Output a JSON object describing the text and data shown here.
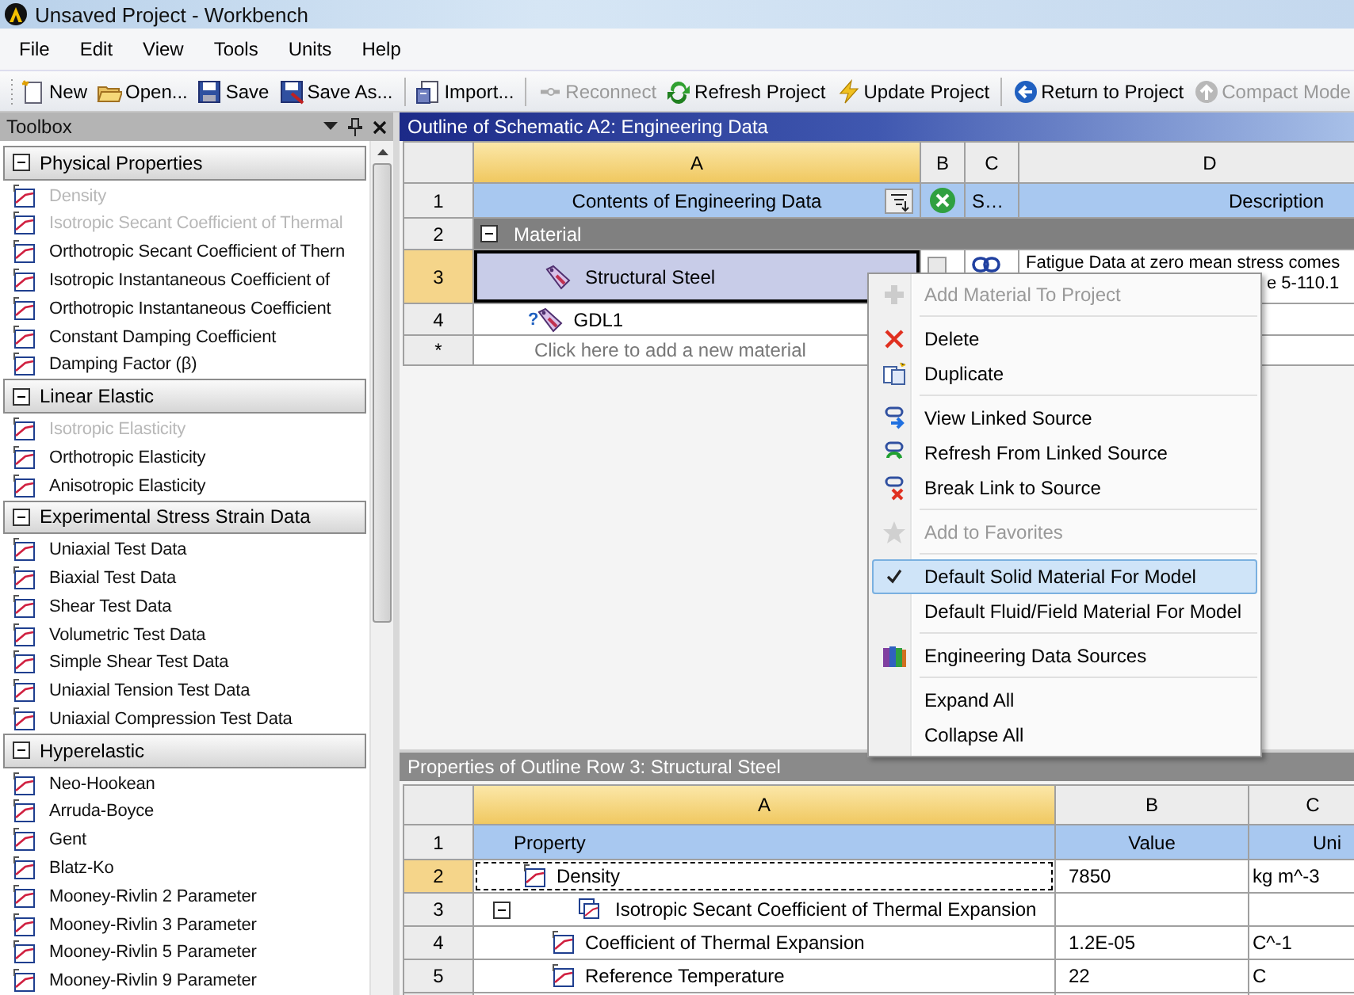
{
  "window": {
    "title": "Unsaved Project - Workbench"
  },
  "menu_bar": [
    "File",
    "Edit",
    "View",
    "Tools",
    "Units",
    "Help"
  ],
  "toolbar": [
    {
      "kind": "button",
      "label": "New",
      "disabled": false
    },
    {
      "kind": "button",
      "label": "Open...",
      "disabled": false
    },
    {
      "kind": "button",
      "label": "Save",
      "disabled": false
    },
    {
      "kind": "button",
      "label": "Save As...",
      "disabled": false
    },
    {
      "kind": "separator"
    },
    {
      "kind": "button",
      "label": "Import...",
      "disabled": false
    },
    {
      "kind": "separator"
    },
    {
      "kind": "button",
      "label": "Reconnect",
      "disabled": true
    },
    {
      "kind": "button",
      "label": "Refresh Project",
      "disabled": false
    },
    {
      "kind": "button",
      "label": "Update Project",
      "disabled": false
    },
    {
      "kind": "separator"
    },
    {
      "kind": "button",
      "label": "Return to Project",
      "disabled": false
    },
    {
      "kind": "button",
      "label": "Compact Mode",
      "disabled": true
    }
  ],
  "toolbox": {
    "title": "Toolbox",
    "groups": [
      {
        "label": "Physical Properties",
        "expanded": true,
        "items": [
          {
            "label": "Density",
            "disabled": true
          },
          {
            "label": "Isotropic Secant Coefficient of Thermal",
            "disabled": true
          },
          {
            "label": "Orthotropic Secant Coefficient of Thern",
            "disabled": false
          },
          {
            "label": "Isotropic Instantaneous Coefficient of",
            "disabled": false
          },
          {
            "label": "Orthotropic Instantaneous Coefficient",
            "disabled": false
          },
          {
            "label": "Constant Damping Coefficient",
            "disabled": false
          },
          {
            "label": "Damping Factor (β)",
            "disabled": false
          }
        ]
      },
      {
        "label": "Linear Elastic",
        "expanded": true,
        "items": [
          {
            "label": "Isotropic Elasticity",
            "disabled": true
          },
          {
            "label": "Orthotropic Elasticity",
            "disabled": false
          },
          {
            "label": "Anisotropic Elasticity",
            "disabled": false
          }
        ]
      },
      {
        "label": "Experimental Stress Strain Data",
        "expanded": true,
        "items": [
          {
            "label": "Uniaxial Test Data",
            "disabled": false
          },
          {
            "label": "Biaxial Test Data",
            "disabled": false
          },
          {
            "label": "Shear Test Data",
            "disabled": false
          },
          {
            "label": "Volumetric Test Data",
            "disabled": false
          },
          {
            "label": "Simple Shear Test Data",
            "disabled": false
          },
          {
            "label": "Uniaxial Tension Test Data",
            "disabled": false
          },
          {
            "label": "Uniaxial Compression Test Data",
            "disabled": false
          }
        ]
      },
      {
        "label": "Hyperelastic",
        "expanded": true,
        "items": [
          {
            "label": "Neo-Hookean",
            "disabled": false
          },
          {
            "label": "Arruda-Boyce",
            "disabled": false
          },
          {
            "label": "Gent",
            "disabled": false
          },
          {
            "label": "Blatz-Ko",
            "disabled": false
          },
          {
            "label": "Mooney-Rivlin 2 Parameter",
            "disabled": false
          },
          {
            "label": "Mooney-Rivlin 3 Parameter",
            "disabled": false
          },
          {
            "label": "Mooney-Rivlin 5 Parameter",
            "disabled": false
          },
          {
            "label": "Mooney-Rivlin 9 Parameter",
            "disabled": false
          }
        ]
      }
    ]
  },
  "outline": {
    "title": "Outline of Schematic A2: Engineering Data",
    "columns": [
      {
        "label": "A",
        "selected": true
      },
      {
        "label": "B",
        "selected": false
      },
      {
        "label": "C",
        "selected": false
      },
      {
        "label": "D",
        "selected": false
      }
    ],
    "header_row": {
      "number": "1",
      "contents": "Contents of Engineering Data",
      "column_c": "S…",
      "description": "Description"
    },
    "groups": [
      {
        "number": "2",
        "label": "Material",
        "expanded": true,
        "children": [
          {
            "number": "3",
            "name": "Structural Steel",
            "selected": true,
            "linked": true,
            "description": [
              "Fatigue Data at zero mean stress comes",
              "e 5-110.1"
            ]
          },
          {
            "number": "4",
            "name": "GDL1",
            "selected": false,
            "linked": false,
            "badge": "?"
          }
        ]
      }
    ],
    "new_row": {
      "number": "*",
      "placeholder": "Click here to add a new material"
    }
  },
  "context_menu": [
    {
      "kind": "item",
      "label": "Add Material To Project",
      "disabled": true,
      "checked": false,
      "selected": false
    },
    {
      "kind": "separator"
    },
    {
      "kind": "item",
      "label": "Delete",
      "disabled": false,
      "checked": false,
      "selected": false
    },
    {
      "kind": "item",
      "label": "Duplicate",
      "disabled": false,
      "checked": false,
      "selected": false
    },
    {
      "kind": "separator"
    },
    {
      "kind": "item",
      "label": "View Linked Source",
      "disabled": false,
      "checked": false,
      "selected": false
    },
    {
      "kind": "item",
      "label": "Refresh From Linked Source",
      "disabled": false,
      "checked": false,
      "selected": false
    },
    {
      "kind": "item",
      "label": "Break Link to Source",
      "disabled": false,
      "checked": false,
      "selected": false
    },
    {
      "kind": "separator"
    },
    {
      "kind": "item",
      "label": "Add to Favorites",
      "disabled": true,
      "checked": false,
      "selected": false
    },
    {
      "kind": "separator"
    },
    {
      "kind": "item",
      "label": "Default Solid Material For Model",
      "disabled": false,
      "checked": true,
      "selected": true
    },
    {
      "kind": "item",
      "label": "Default Fluid/Field Material For Model",
      "disabled": false,
      "checked": false,
      "selected": false
    },
    {
      "kind": "separator"
    },
    {
      "kind": "item",
      "label": "Engineering Data Sources",
      "disabled": false,
      "checked": false,
      "selected": false
    },
    {
      "kind": "separator"
    },
    {
      "kind": "item",
      "label": "Expand All",
      "disabled": false,
      "checked": false,
      "selected": false
    },
    {
      "kind": "item",
      "label": "Collapse All",
      "disabled": false,
      "checked": false,
      "selected": false
    }
  ],
  "properties": {
    "title": "Properties of Outline Row 3: Structural Steel",
    "columns": [
      {
        "label": "A",
        "selected": true
      },
      {
        "label": "B",
        "selected": false
      },
      {
        "label": "C",
        "selected": false
      }
    ],
    "header_row": {
      "number": "1",
      "property": "Property",
      "value": "Value",
      "unit": "Uni"
    },
    "rows": [
      {
        "kind": "property",
        "number": "2",
        "property": "Density",
        "value": "7850",
        "unit": "kg m^-3",
        "selected": true
      },
      {
        "kind": "group",
        "number": "3",
        "property": "Isotropic Secant Coefficient of Thermal Expansion",
        "selected": false,
        "expanded": true,
        "children": [
          {
            "kind": "property",
            "number": "4",
            "property": "Coefficient of Thermal Expansion",
            "value": "1.2E-05",
            "unit": "C^-1",
            "selected": false
          },
          {
            "kind": "property",
            "number": "5",
            "property": "Reference Temperature",
            "value": "22",
            "unit": "C",
            "selected": false
          }
        ]
      }
    ]
  }
}
